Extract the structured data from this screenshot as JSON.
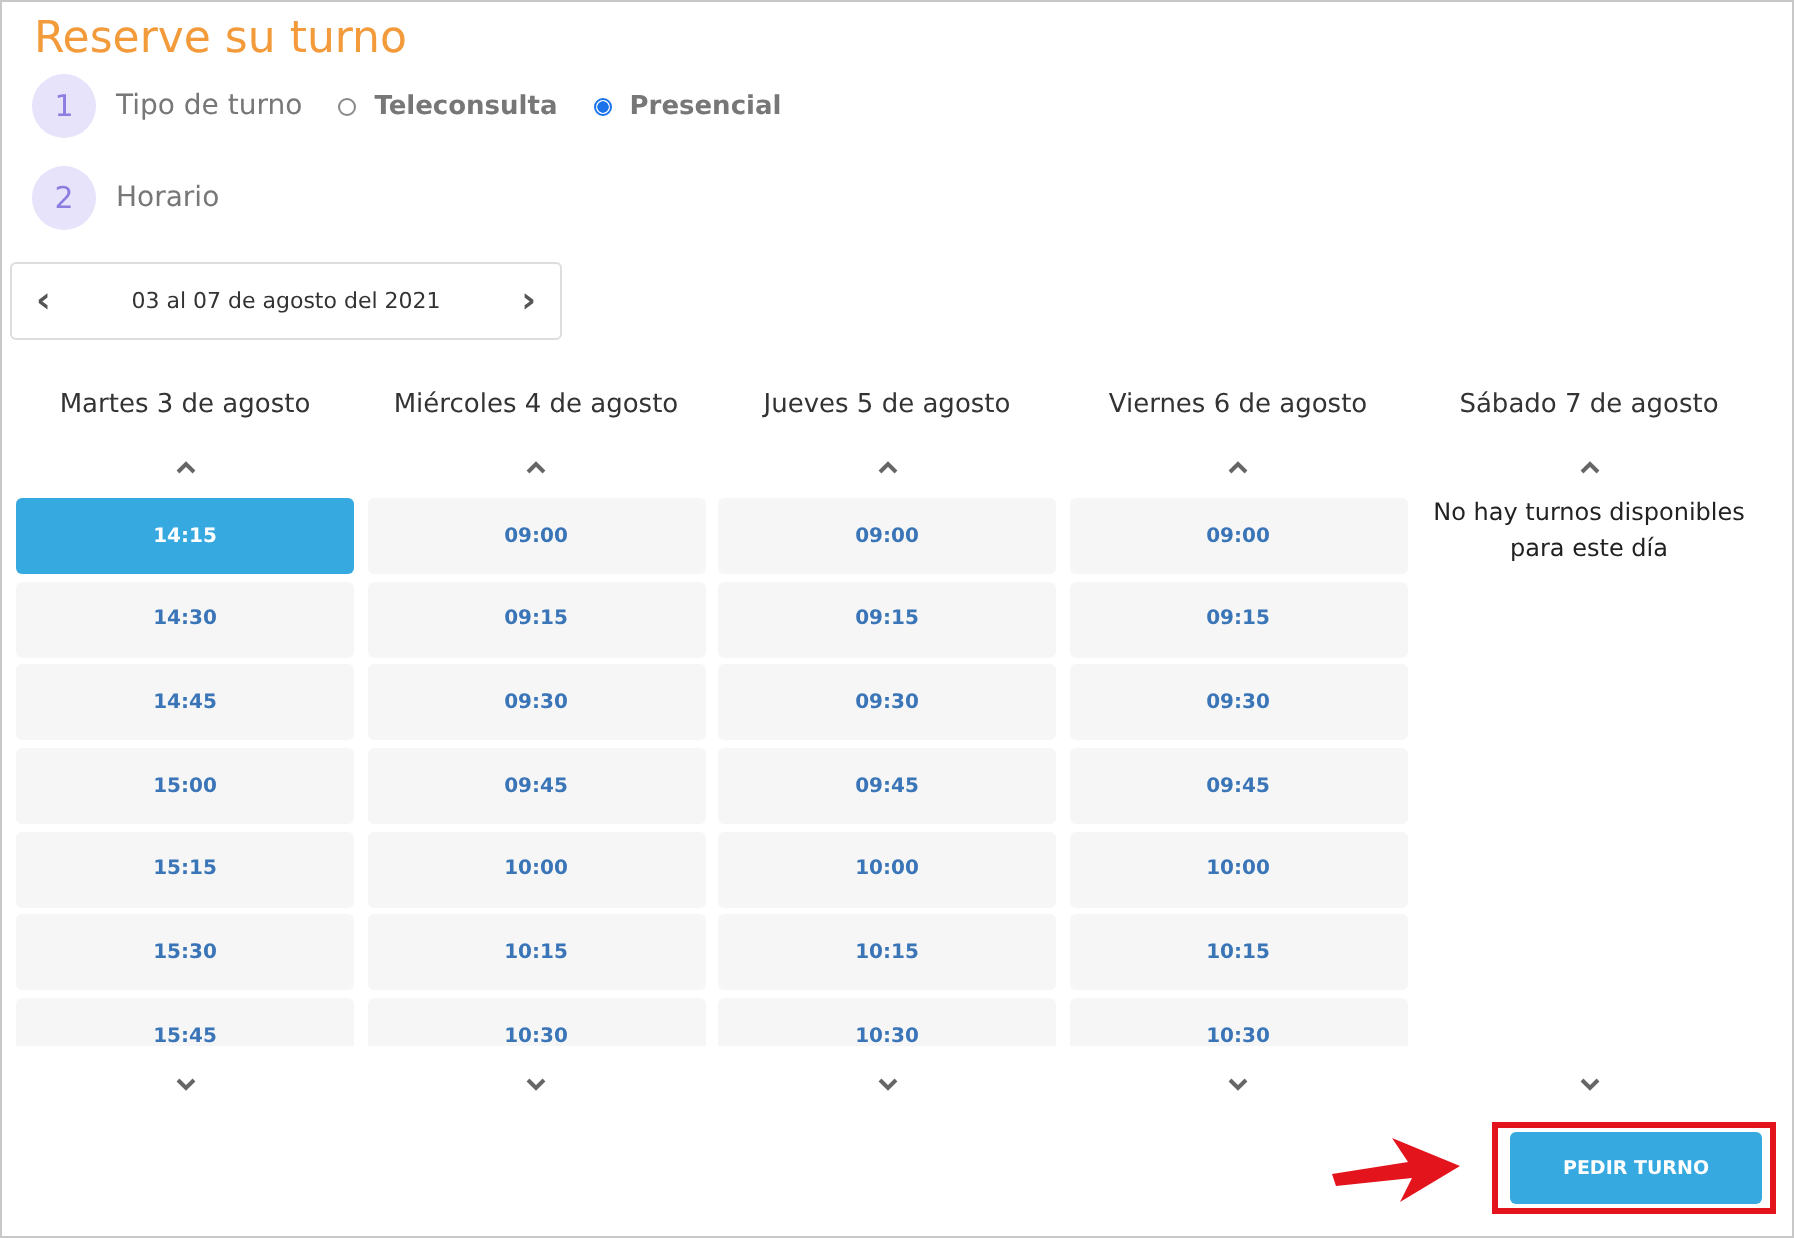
{
  "title": "Reserve su turno",
  "steps": [
    {
      "number": "1",
      "label": "Tipo de turno",
      "kind": "options",
      "options": [
        {
          "label": "Teleconsulta",
          "selected": false
        },
        {
          "label": "Presencial",
          "selected": true
        }
      ]
    },
    {
      "number": "2",
      "label": "Horario",
      "kind": "plain"
    }
  ],
  "week": {
    "label": "03 al 07 de agosto del 2021",
    "prev": "‹",
    "next": "›"
  },
  "days": [
    {
      "label": "Martes 3 de agosto",
      "slots": [
        {
          "time": "14:15",
          "selected": true
        },
        {
          "time": "14:30",
          "selected": false
        },
        {
          "time": "14:45",
          "selected": false
        },
        {
          "time": "15:00",
          "selected": false
        },
        {
          "time": "15:15",
          "selected": false
        },
        {
          "time": "15:30",
          "selected": false
        },
        {
          "time": "15:45",
          "selected": false
        }
      ]
    },
    {
      "label": "Miércoles 4 de agosto",
      "slots": [
        {
          "time": "09:00",
          "selected": false
        },
        {
          "time": "09:15",
          "selected": false
        },
        {
          "time": "09:30",
          "selected": false
        },
        {
          "time": "09:45",
          "selected": false
        },
        {
          "time": "10:00",
          "selected": false
        },
        {
          "time": "10:15",
          "selected": false
        },
        {
          "time": "10:30",
          "selected": false
        }
      ]
    },
    {
      "label": "Jueves 5 de agosto",
      "slots": [
        {
          "time": "09:00",
          "selected": false
        },
        {
          "time": "09:15",
          "selected": false
        },
        {
          "time": "09:30",
          "selected": false
        },
        {
          "time": "09:45",
          "selected": false
        },
        {
          "time": "10:00",
          "selected": false
        },
        {
          "time": "10:15",
          "selected": false
        },
        {
          "time": "10:30",
          "selected": false
        }
      ]
    },
    {
      "label": "Viernes 6 de agosto",
      "slots": [
        {
          "time": "09:00",
          "selected": false
        },
        {
          "time": "09:15",
          "selected": false
        },
        {
          "time": "09:30",
          "selected": false
        },
        {
          "time": "09:45",
          "selected": false
        },
        {
          "time": "10:00",
          "selected": false
        },
        {
          "time": "10:15",
          "selected": false
        },
        {
          "time": "10:30",
          "selected": false
        }
      ]
    },
    {
      "label": "Sábado 7 de agosto",
      "message": "No hay turnos disponibles para este día"
    }
  ],
  "submit": {
    "label": "PEDIR TURNO",
    "highlighted": true
  }
}
